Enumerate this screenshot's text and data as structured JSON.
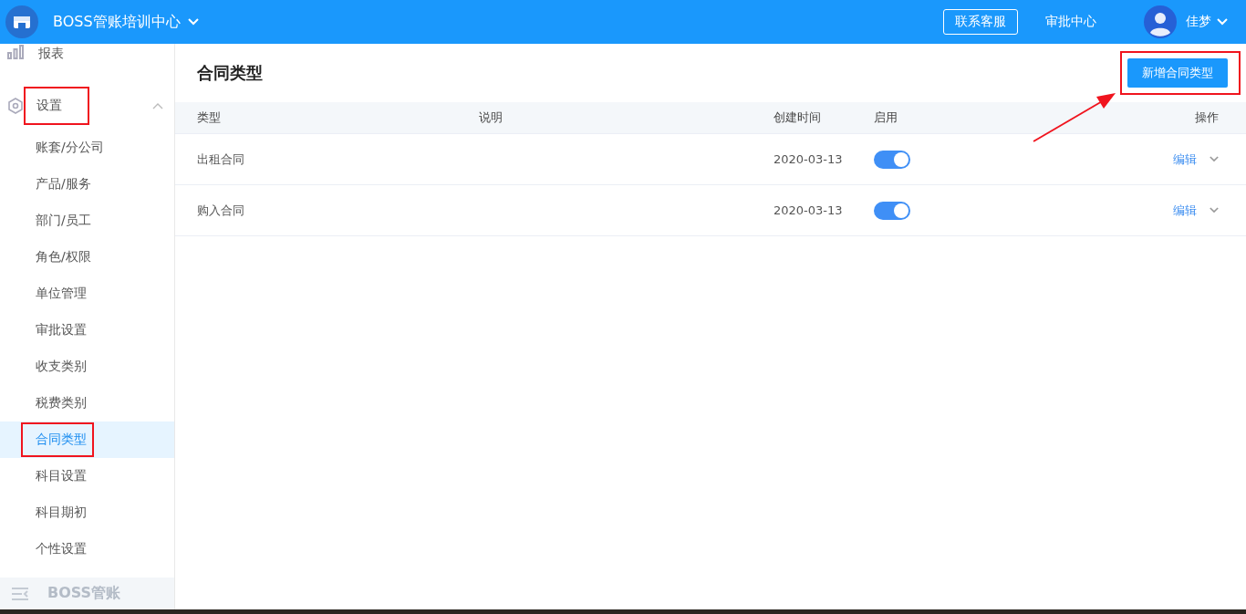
{
  "header": {
    "org_name": "BOSS管账培训中心",
    "contact_button": "联系客服",
    "approval_link": "审批中心",
    "user_name": "佳梦"
  },
  "sidebar": {
    "items": [
      {
        "label": "报表",
        "kind": "report"
      },
      {
        "label": "设置",
        "kind": "settings",
        "expanded": true,
        "highlighted": true,
        "children": [
          {
            "label": "账套/分公司",
            "selected": false,
            "highlighted": false
          },
          {
            "label": "产品/服务",
            "selected": false,
            "highlighted": false
          },
          {
            "label": "部门/员工",
            "selected": false,
            "highlighted": false
          },
          {
            "label": "角色/权限",
            "selected": false,
            "highlighted": false
          },
          {
            "label": "单位管理",
            "selected": false,
            "highlighted": false
          },
          {
            "label": "审批设置",
            "selected": false,
            "highlighted": false
          },
          {
            "label": "收支类别",
            "selected": false,
            "highlighted": false
          },
          {
            "label": "税费类别",
            "selected": false,
            "highlighted": false
          },
          {
            "label": "合同类型",
            "selected": true,
            "highlighted": true
          },
          {
            "label": "科目设置",
            "selected": false,
            "highlighted": false
          },
          {
            "label": "科目期初",
            "selected": false,
            "highlighted": false
          },
          {
            "label": "个性设置",
            "selected": false,
            "highlighted": false
          }
        ]
      }
    ],
    "footer": "BOSS管账"
  },
  "page": {
    "title": "合同类型",
    "add_button": {
      "label": "新增合同类型",
      "highlighted": true
    },
    "annotation_arrow": true
  },
  "table": {
    "columns": [
      "类型",
      "说明",
      "创建时间",
      "启用",
      "操作"
    ],
    "rows": [
      {
        "type": "出租合同",
        "created": "2020-03-13",
        "enabled": true,
        "action": "编辑"
      },
      {
        "type": "购入合同",
        "created": "2020-03-13",
        "enabled": true,
        "action": "编辑"
      }
    ]
  }
}
